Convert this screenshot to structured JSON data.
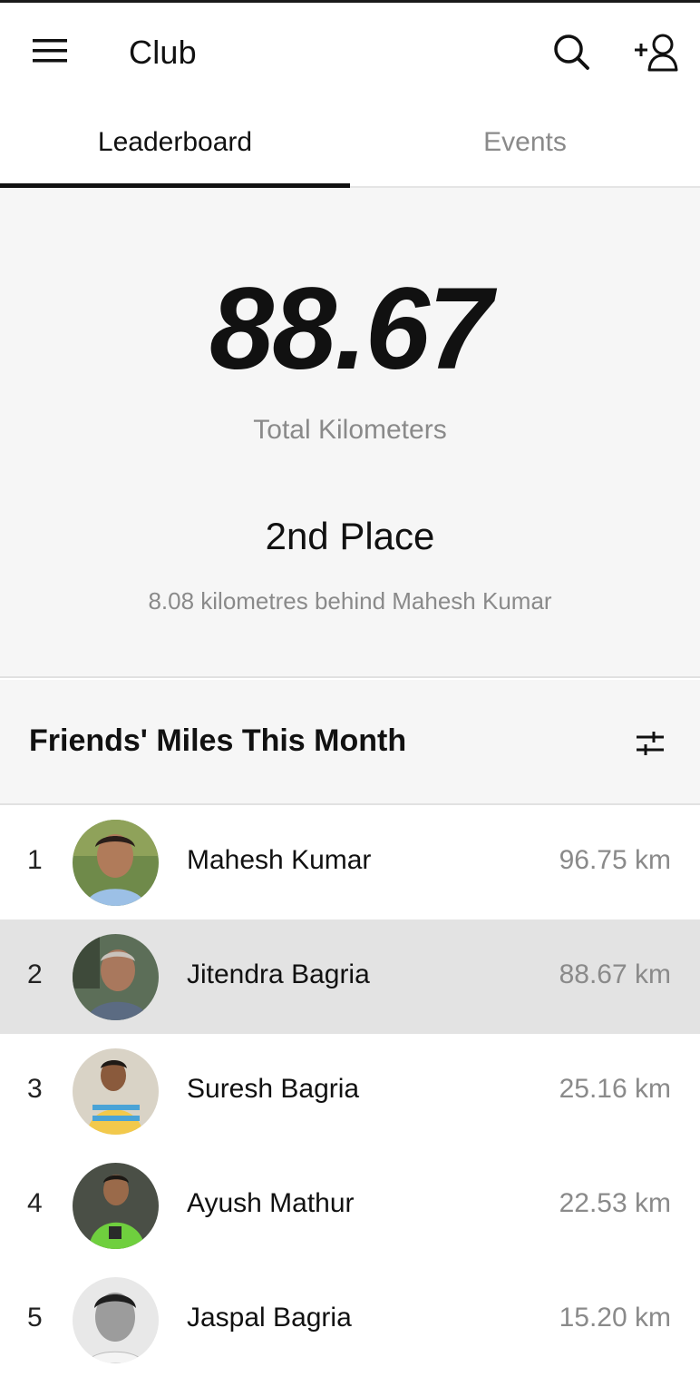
{
  "app": {
    "title": "Club",
    "icons": {
      "menu": "hamburger-menu-icon",
      "search": "search-icon",
      "add_friend": "add-user-icon",
      "filter": "sliders-filter-icon"
    }
  },
  "tabs": [
    {
      "label": "Leaderboard",
      "active": true
    },
    {
      "label": "Events",
      "active": false
    }
  ],
  "summary": {
    "total": "88.67",
    "total_label": "Total Kilometers",
    "place": "2nd Place",
    "behind": "8.08 kilometres behind Mahesh Kumar"
  },
  "section": {
    "title": "Friends' Miles This Month"
  },
  "leaderboard": [
    {
      "rank": "1",
      "name": "Mahesh Kumar",
      "distance": "96.75 km",
      "highlight": false
    },
    {
      "rank": "2",
      "name": "Jitendra Bagria",
      "distance": "88.67 km",
      "highlight": true
    },
    {
      "rank": "3",
      "name": "Suresh Bagria",
      "distance": "25.16 km",
      "highlight": false
    },
    {
      "rank": "4",
      "name": "Ayush Mathur",
      "distance": "22.53 km",
      "highlight": false
    },
    {
      "rank": "5",
      "name": "Jaspal Bagria",
      "distance": "15.20 km",
      "highlight": false
    }
  ],
  "colors": {
    "accent": "#111111",
    "muted_text": "#8a8a8a",
    "panel_bg": "#f6f6f6",
    "highlight_row": "#e3e3e3"
  }
}
